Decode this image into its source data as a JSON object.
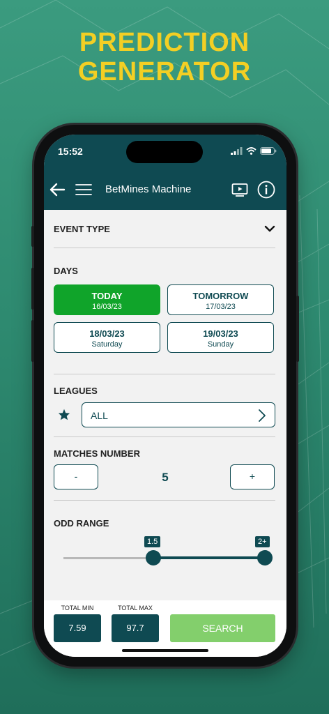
{
  "headline": {
    "line1": "PREDICTION",
    "line2": "GENERATOR"
  },
  "status": {
    "time": "15:52"
  },
  "appbar": {
    "title": "BetMines Machine"
  },
  "event_type": {
    "label": "EVENT TYPE"
  },
  "days": {
    "label": "DAYS",
    "items": [
      {
        "name": "TODAY",
        "date": "16/03/23",
        "active": true
      },
      {
        "name": "TOMORROW",
        "date": "17/03/23",
        "active": false
      },
      {
        "name": "18/03/23",
        "date": "Saturday",
        "active": false
      },
      {
        "name": "19/03/23",
        "date": "Sunday",
        "active": false
      }
    ]
  },
  "leagues": {
    "label": "LEAGUES",
    "value": "ALL"
  },
  "matches": {
    "label": "MATCHES NUMBER",
    "minus": "-",
    "plus": "+",
    "value": "5"
  },
  "odd_range": {
    "label": "ODD RANGE",
    "min_label": "1.5",
    "max_label": "2+"
  },
  "totals": {
    "min_label": "TOTAL MIN",
    "min_value": "7.59",
    "max_label": "TOTAL MAX",
    "max_value": "97.7",
    "search": "SEARCH"
  },
  "colors": {
    "accent": "#0f4a52",
    "active": "#10a42a",
    "search": "#83cf6c",
    "headline": "#f3cf24"
  }
}
